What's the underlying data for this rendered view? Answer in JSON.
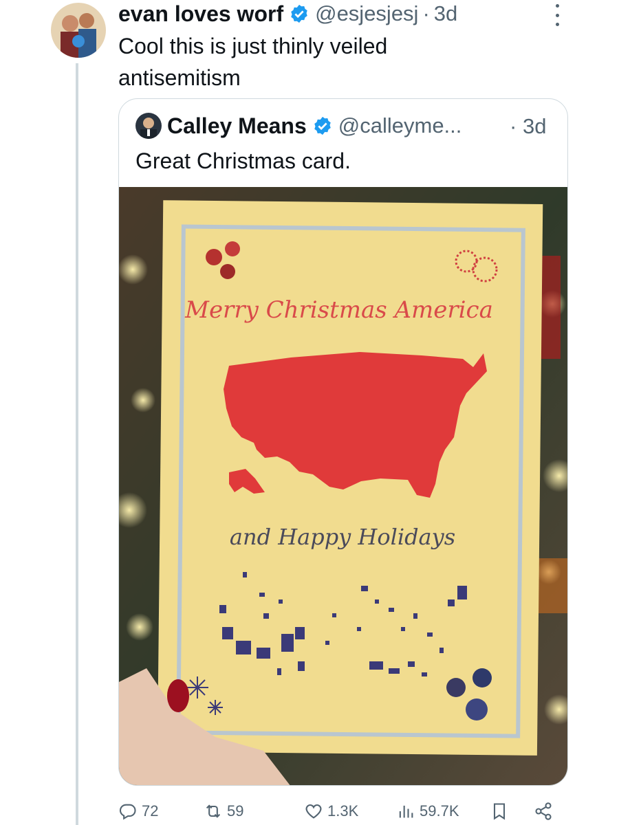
{
  "tweet": {
    "author_name": "evan loves worf",
    "handle": "@esjesjesj",
    "separator": "·",
    "time": "3d",
    "text": "Cool this is just thinly veiled antisemitism",
    "avatar_icon": "avatar-photo",
    "verified_icon": "verified-badge-icon",
    "more_icon": "more-vertical-icon"
  },
  "quote": {
    "author_name": "Calley Means",
    "handle": "@calleyme...",
    "separator": "·",
    "time": "3d",
    "text": "Great Christmas card.",
    "media": {
      "card_title": "Merry Christmas America",
      "card_subtitle": "and Happy Holidays"
    }
  },
  "actions": {
    "replies": "72",
    "reposts": "59",
    "likes": "1.3K",
    "views": "59.7K",
    "icons": [
      "reply-icon",
      "repost-icon",
      "like-icon",
      "views-icon",
      "bookmark-icon",
      "share-icon"
    ]
  },
  "colors": {
    "text_primary": "#0f1419",
    "text_secondary": "#536471",
    "verified_blue": "#1d9bf0",
    "border": "#cfd9de",
    "card_paper": "#f0d98a",
    "map_red": "#e03a3a",
    "map_blue": "#3b3a78"
  }
}
